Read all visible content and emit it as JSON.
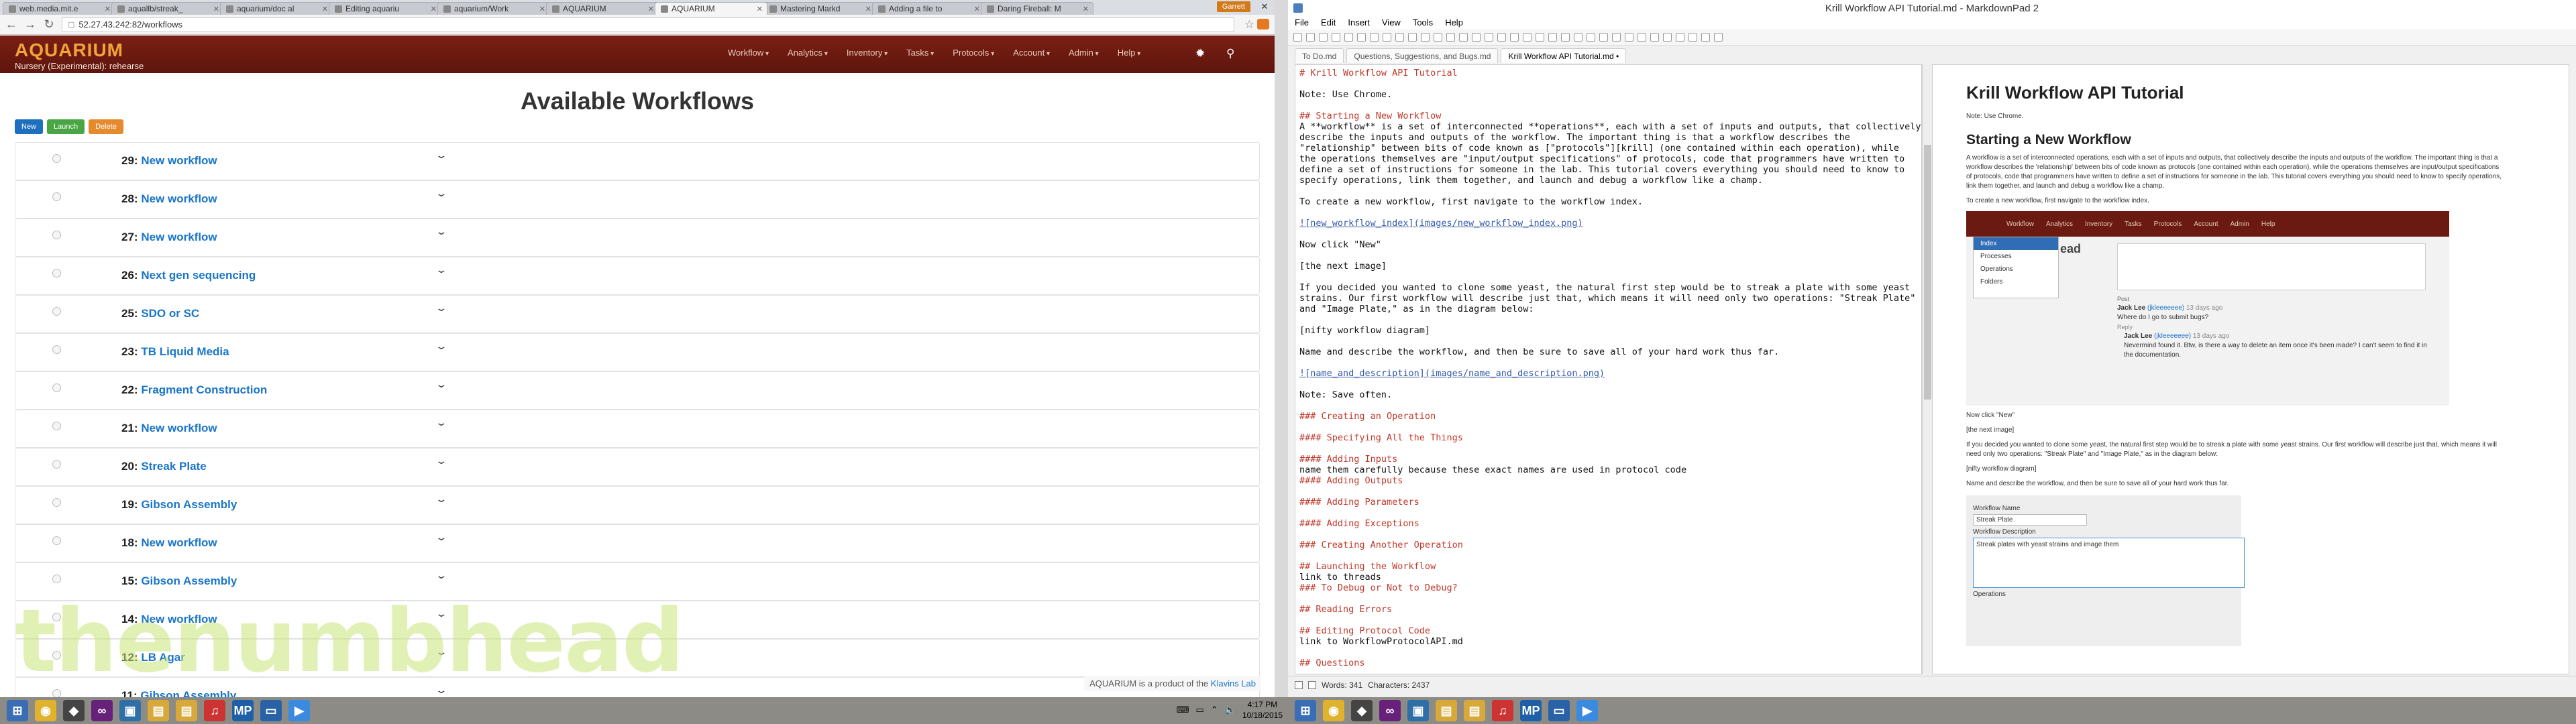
{
  "browser": {
    "tabs": [
      {
        "label": "web.media.mit.e"
      },
      {
        "label": "aquallb/streak_"
      },
      {
        "label": "aquarium/doc al"
      },
      {
        "label": "Editing aquariu"
      },
      {
        "label": "aquarium/Work"
      },
      {
        "label": "AQUARIUM"
      },
      {
        "label": "AQUARIUM",
        "active": true
      },
      {
        "label": "Mastering Markd"
      },
      {
        "label": "Adding a file to"
      },
      {
        "label": "Daring Fireball: M"
      }
    ],
    "user_badge": "Garrett",
    "url": "52.27.43.242:82/workflows"
  },
  "aquarium": {
    "logo": "AQUARIUM",
    "subtitle": "Nursery (Experimental): rehearse",
    "menu": [
      "Workflow",
      "Analytics",
      "Inventory",
      "Tasks",
      "Protocols",
      "Account",
      "Admin",
      "Help"
    ],
    "title": "Available Workflows",
    "buttons": {
      "new": "New",
      "launch": "Launch",
      "delete": "Delete"
    },
    "workflows": [
      {
        "id": "29:",
        "name": "New workflow"
      },
      {
        "id": "28:",
        "name": "New workflow"
      },
      {
        "id": "27:",
        "name": "New workflow"
      },
      {
        "id": "26:",
        "name": "Next gen sequencing"
      },
      {
        "id": "25:",
        "name": "SDO or SC"
      },
      {
        "id": "23:",
        "name": "TB Liquid Media"
      },
      {
        "id": "22:",
        "name": "Fragment Construction"
      },
      {
        "id": "21:",
        "name": "New workflow"
      },
      {
        "id": "20:",
        "name": "Streak Plate"
      },
      {
        "id": "19:",
        "name": "Gibson Assembly"
      },
      {
        "id": "18:",
        "name": "New workflow"
      },
      {
        "id": "15:",
        "name": "Gibson Assembly"
      },
      {
        "id": "14:",
        "name": "New workflow"
      },
      {
        "id": "12:",
        "name": "LB Agar"
      },
      {
        "id": "11:",
        "name": "Gibson Assembly"
      }
    ],
    "watermark": "thenumbhead",
    "footer_prefix": "AQUARIUM is a product of the",
    "footer_link": "Klavins Lab"
  },
  "editor_app": {
    "window_title": "Krill Workflow API Tutorial.md - MarkdownPad 2",
    "menu": [
      "File",
      "Edit",
      "Insert",
      "View",
      "Tools",
      "Help"
    ],
    "tabs": [
      "To Do.md",
      "Questions, Suggestions, and Bugs.md",
      "Krill Workflow API Tutorial.md •"
    ],
    "lines": [
      {
        "t": "# Krill Workflow API Tutorial",
        "c": "h"
      },
      {
        "t": ""
      },
      {
        "t": "Note: Use Chrome."
      },
      {
        "t": ""
      },
      {
        "t": "## Starting a New Workflow",
        "c": "h"
      },
      {
        "t": "A **workflow** is a set of interconnected **operations**, each with a set of inputs and outputs, that collectively"
      },
      {
        "t": "describe the inputs and outputs of the workflow. The important thing is that a workflow describes the"
      },
      {
        "t": "\"relationship\" between bits of code known as [\"protocols\"][krill] (one contained within each operation), while"
      },
      {
        "t": "the operations themselves are \"input/output specifications\" of protocols, code that programmers have written to"
      },
      {
        "t": "define a set of instructions for someone in the lab. This tutorial covers everything you should need to know to"
      },
      {
        "t": "specify operations, link them together, and launch and debug a workflow like a champ."
      },
      {
        "t": ""
      },
      {
        "t": "To create a new workflow, first navigate to the workflow index."
      },
      {
        "t": ""
      },
      {
        "t": "![new_workflow_index](images/new_workflow_index.png)",
        "c": "lk"
      },
      {
        "t": ""
      },
      {
        "t": "Now click \"New\""
      },
      {
        "t": ""
      },
      {
        "t": "[the next image]"
      },
      {
        "t": ""
      },
      {
        "t": "If you decided you wanted to clone some yeast, the natural first step would be to streak a plate with some yeast"
      },
      {
        "t": "strains. Our first workflow will describe just that, which means it will need only two operations: \"Streak Plate\""
      },
      {
        "t": "and \"Image Plate,\" as in the diagram below:"
      },
      {
        "t": ""
      },
      {
        "t": "[nifty workflow diagram]"
      },
      {
        "t": ""
      },
      {
        "t": "Name and describe the workflow, and then be sure to save all of your hard work thus far."
      },
      {
        "t": ""
      },
      {
        "t": "![name_and_description](images/name_and_description.png)",
        "c": "lk"
      },
      {
        "t": ""
      },
      {
        "t": "Note: Save often."
      },
      {
        "t": ""
      },
      {
        "t": "### Creating an Operation",
        "c": "h"
      },
      {
        "t": ""
      },
      {
        "t": "#### Specifying All the Things",
        "c": "h"
      },
      {
        "t": ""
      },
      {
        "t": "#### Adding Inputs",
        "c": "h"
      },
      {
        "t": "name them carefully because these exact names are used in protocol code"
      },
      {
        "t": "#### Adding Outputs",
        "c": "h"
      },
      {
        "t": ""
      },
      {
        "t": "#### Adding Parameters",
        "c": "h"
      },
      {
        "t": ""
      },
      {
        "t": "#### Adding Exceptions",
        "c": "h"
      },
      {
        "t": ""
      },
      {
        "t": "### Creating Another Operation",
        "c": "h"
      },
      {
        "t": ""
      },
      {
        "t": "## Launching the Workflow",
        "c": "h"
      },
      {
        "t": "link to threads"
      },
      {
        "t": "### To Debug or Not to Debug?",
        "c": "h"
      },
      {
        "t": ""
      },
      {
        "t": "## Reading Errors",
        "c": "h"
      },
      {
        "t": ""
      },
      {
        "t": "## Editing Protocol Code",
        "c": "h"
      },
      {
        "t": "link to WorkflowProtocolAPI.md"
      },
      {
        "t": ""
      },
      {
        "t": "## Questions",
        "c": "h"
      }
    ],
    "preview": {
      "h1": "Krill Workflow API Tutorial",
      "note": "Note: Use Chrome.",
      "h2": "Starting a New Workflow",
      "p1": "A workflow is a set of interconnected operations, each with a set of inputs and outputs, that collectively describe the inputs and outputs of the workflow. The important thing is that a workflow describes the 'relationship' between bits of code known as protocols (one contained within each operation), while the operations themselves are input/output specifications of protocols, code that programmers have written to define a set of instructions for someone in the lab. This tutorial covers everything you should need to know to specify operations, link them together, and launch and debug a workflow like a champ.",
      "p2": "To create a new workflow, first navigate to the workflow index.",
      "mini_menu": [
        "Workflow",
        "Analytics",
        "Inventory",
        "Tasks",
        "Protocols",
        "Account",
        "Admin",
        "Help"
      ],
      "mini_drop": [
        "Index",
        "Processes",
        "Operations",
        "Folders"
      ],
      "mini_frag": "ead",
      "mini_post": "Post",
      "mini_c1_name": "Jack Lee",
      "mini_c1_user": "(jkleeeeeee)",
      "mini_c1_time": "13 days ago",
      "mini_c1_text": "Where do I go to submit bugs?",
      "mini_reply": "Reply",
      "mini_c2_name": "Jack Lee",
      "mini_c2_user": "(jkleeeeeee)",
      "mini_c2_time": "13 days ago",
      "mini_c2_text": "Nevermind found it. Btw, is there a way to delete an item once it's been made? I can't seem to find it in the documentation.",
      "p3": "Now click \"New\"",
      "p4": "[the next image]",
      "p5": "If you decided you wanted to clone some yeast, the natural first step would be to streak a plate with some yeast strains. Our first workflow will describe just that, which means it will need only two operations: \"Streak Plate\" and \"Image Plate,\" as in the diagram below:",
      "p6": "[nifty workflow diagram]",
      "p7": "Name and describe the workflow, and then be sure to save all of your hard work thus far.",
      "form_name_label": "Workflow Name",
      "form_name_value": "Streak Plate",
      "form_desc_label": "Workflow Description",
      "form_desc_value": "Streak plates with yeast strains and image them",
      "form_ops_label": "Operations"
    },
    "status_words": "Words: 341",
    "status_chars": "Characters: 2437"
  },
  "taskbar": {
    "time": "4:17 PM",
    "date": "10/18/2015",
    "mp_label": "MP"
  }
}
